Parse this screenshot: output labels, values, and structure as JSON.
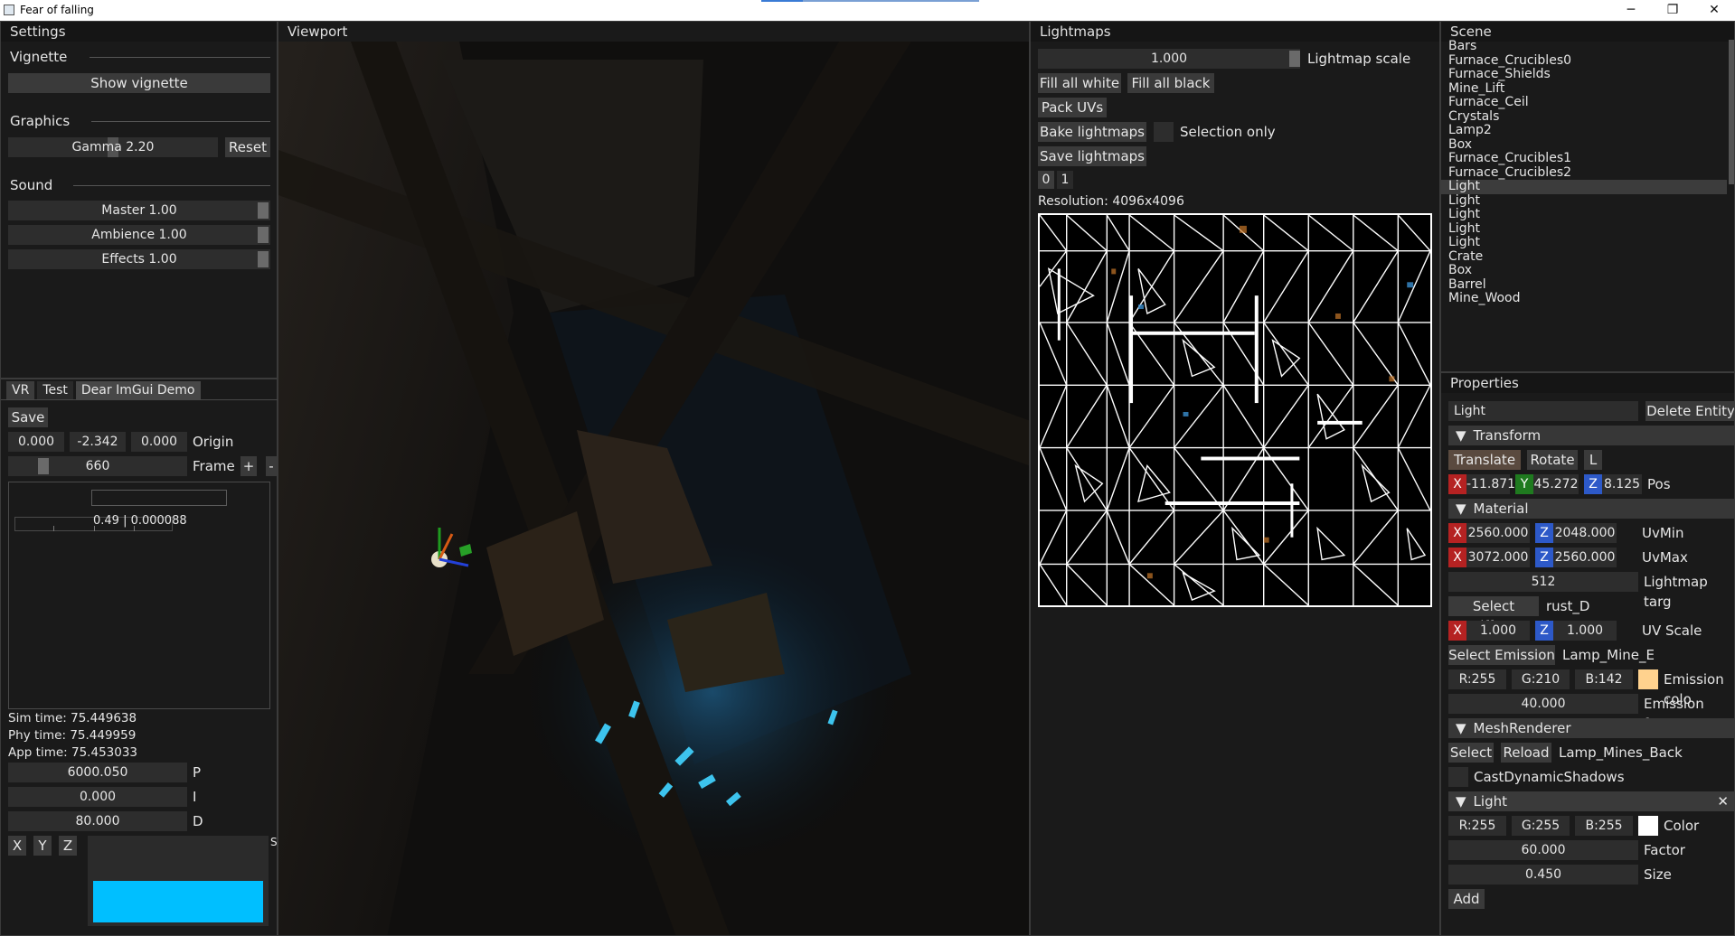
{
  "window": {
    "title": "Fear of falling",
    "minimize": "─",
    "maximize": "❐",
    "close": "✕"
  },
  "settings": {
    "title": "Settings",
    "vignette": {
      "header": "Vignette",
      "button": "Show vignette"
    },
    "graphics": {
      "header": "Graphics",
      "gamma": "Gamma 2.20",
      "gamma_level": 0.5,
      "reset": "Reset"
    },
    "sound": {
      "header": "Sound",
      "master": "Master 1.00",
      "ambience": "Ambience 1.00",
      "effects": "Effects 1.00"
    }
  },
  "tools": {
    "tabs": [
      "VR",
      "Test",
      "Dear ImGui Demo"
    ],
    "save": "Save",
    "origin": {
      "x": "0.000",
      "y": "-2.342",
      "z": "0.000",
      "label": "Origin"
    },
    "frame": {
      "value": "660",
      "label": "Frame",
      "plus": "+",
      "minus": "-"
    },
    "readout": "0.49 | 0.000088",
    "sim_time": "Sim time: 75.449638",
    "phy_time": "Phy time: 75.449959",
    "app_time": "App time: 75.453033",
    "p": {
      "value": "6000.050",
      "label": "P"
    },
    "i": {
      "value": "0.000",
      "label": "I"
    },
    "d": {
      "value": "80.000",
      "label": "D"
    },
    "axis_buttons": [
      "X",
      "Y",
      "Z"
    ],
    "bar_color": "#00bfff"
  },
  "viewport": {
    "title": "Viewport"
  },
  "lightmaps": {
    "title": "Lightmaps",
    "scale_value": "1.000",
    "scale_label": "Lightmap scale",
    "fill_white": "Fill all white",
    "fill_black": "Fill all black",
    "pack_uvs": "Pack UVs",
    "bake": "Bake lightmaps",
    "selection_only": "Selection only",
    "save": "Save lightmaps",
    "page_tabs": [
      "0",
      "1"
    ],
    "resolution": "Resolution: 4096x4096"
  },
  "scene": {
    "title": "Scene",
    "items": [
      "Bars",
      "Furnace_Crucibles0",
      "Furnace_Shields",
      "Mine_Lift",
      "Furnace_Ceil",
      "Crystals",
      "Lamp2",
      "Box",
      "Furnace_Crucibles1",
      "Furnace_Crucibles2",
      "Light",
      "Light",
      "Light",
      "Light",
      "Light",
      "Crate",
      "Box",
      "Barrel",
      "Mine_Wood"
    ],
    "selected_index": 10
  },
  "properties": {
    "title": "Properties",
    "name": "Light",
    "delete": "Delete Entity",
    "transform": {
      "header": "Transform",
      "translate": "Translate",
      "rotate": "Rotate",
      "local": "L",
      "x": "-11.871",
      "y": "45.272",
      "z": "8.125",
      "label": "Pos"
    },
    "material": {
      "header": "Material",
      "uvmin_x": "2560.000",
      "uvmin_z": "2048.000",
      "uvmin_label": "UvMin",
      "uvmax_x": "3072.000",
      "uvmax_z": "2560.000",
      "uvmax_label": "UvMax",
      "lightmap_target": "512",
      "lightmap_target_label": "Lightmap targ",
      "select_diffuse": "Select Diffuse",
      "diffuse_name": "rust_D",
      "uvscale_x": "1.000",
      "uvscale_z": "1.000",
      "uvscale_label": "UV Scale",
      "select_emission": "Select Emission",
      "emission_name": "Lamp_Mine_E",
      "emission_r": "R:255",
      "emission_g": "G:210",
      "emission_b": "B:142",
      "emission_color_label": "Emission colo",
      "emission_swatch": "#ffd28e",
      "emission_factor": "40.000",
      "emission_factor_label": "Emission facto"
    },
    "mesh": {
      "header": "MeshRenderer",
      "select": "Select",
      "reload": "Reload",
      "mesh_name": "Lamp_Mines_Back",
      "cast_shadows": "CastDynamicShadows"
    },
    "light": {
      "header": "Light",
      "close": "✕",
      "r": "R:255",
      "g": "G:255",
      "b": "B:255",
      "color_label": "Color",
      "swatch": "#ffffff",
      "factor": "60.000",
      "factor_label": "Factor",
      "size": "0.450",
      "size_label": "Size"
    },
    "add": "Add",
    "axis_x": "X",
    "axis_y": "Y",
    "axis_z": "Z",
    "arrow": "▼"
  }
}
